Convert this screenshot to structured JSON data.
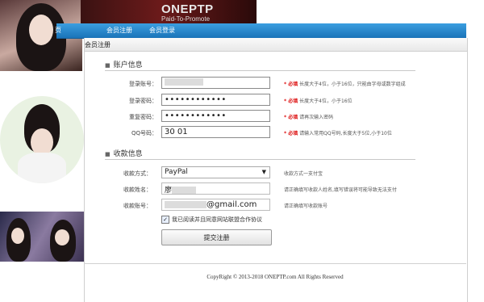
{
  "banner": {
    "logo_text": "ONEPTP",
    "tagline": "Paid-To-Promote"
  },
  "nav": {
    "items": [
      "页",
      "会员注册",
      "会员登录"
    ]
  },
  "panel_title": "会员注册",
  "sections": {
    "account": "账户信息",
    "payment": "收款信息"
  },
  "account_fields": [
    {
      "label": "登录账号：",
      "value": "",
      "type": "text",
      "hint_required": "* 必填",
      "hint": "长度大于4位，小于16位，只能由字母或数字组成"
    },
    {
      "label": "登录密码：",
      "value": "••••••••••••",
      "type": "password",
      "hint_required": "* 必填",
      "hint": "长度大于4位，小于16位"
    },
    {
      "label": "重复密码：",
      "value": "••••••••••••",
      "type": "password",
      "hint_required": "* 必填",
      "hint": "请再次输入密码"
    },
    {
      "label": "QQ号码：",
      "value": "30          01",
      "type": "text",
      "hint_required": "* 必填",
      "hint": "请输入常用QQ号码,长度大于5位,小于10位"
    }
  ],
  "payment_fields": {
    "method_label": "收款方式：",
    "method_value": "PayPal",
    "method_hint": "收款方式一支付宝",
    "name_label": "收款姓名：",
    "name_value": "廖",
    "name_hint": "请正确填写收款人姓名,填写错误将可能导致无法支付",
    "account_label": "收款账号：",
    "account_value": "@gmail.com",
    "account_hint": "请正确填写收款账号"
  },
  "agreement": {
    "checked": true,
    "text": "我已阅读并且同意网站联盟合作协议"
  },
  "submit_label": "提交注册",
  "copyright": "CopyRight © 2013-2018 ONEPTP.com All Rights Reserved",
  "colors": {
    "nav_blue": "#1a73b8",
    "required_red": "#dd1111"
  }
}
